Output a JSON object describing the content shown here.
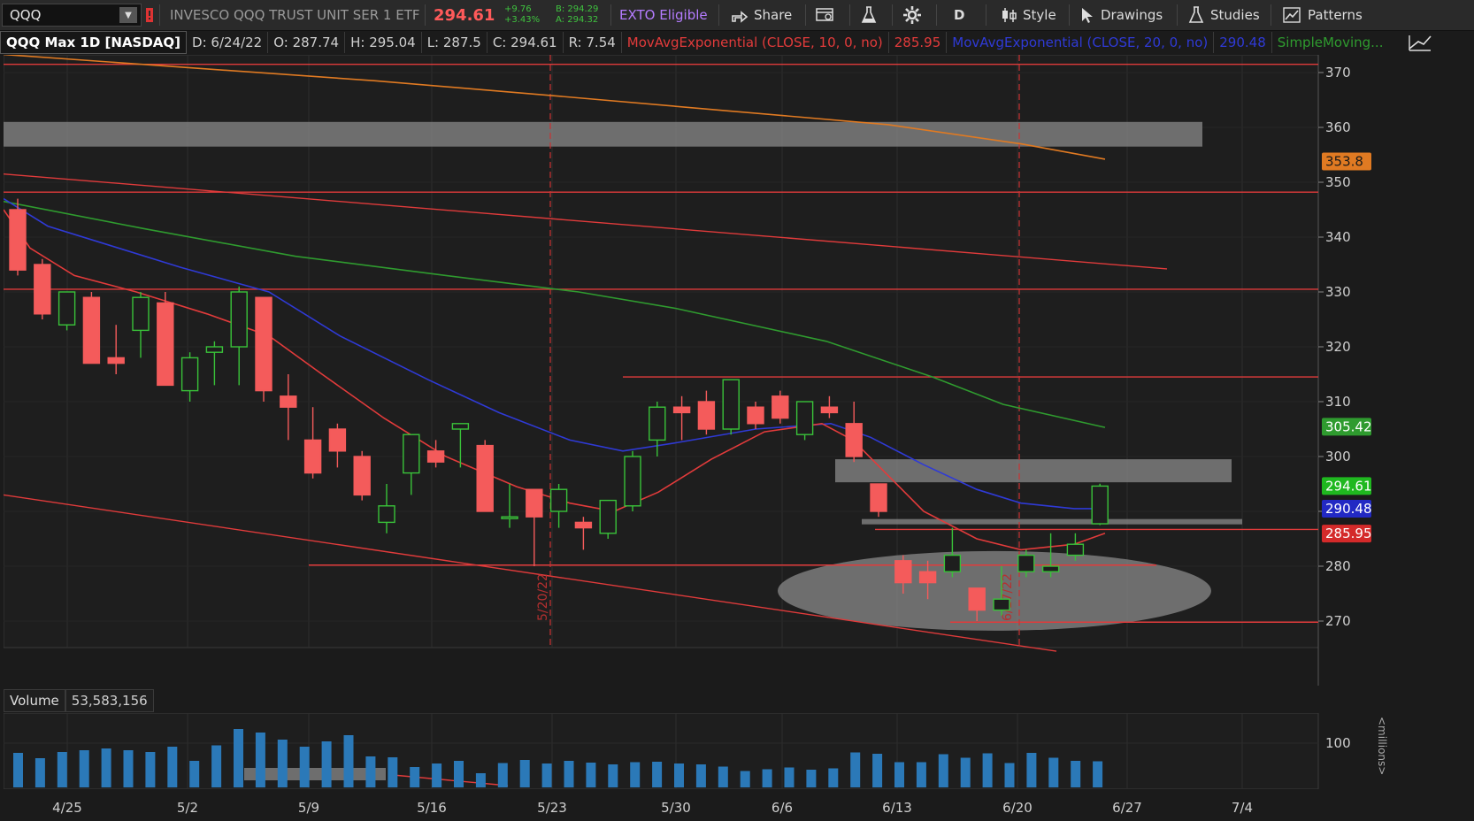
{
  "toolbar": {
    "symbol": "QQQ",
    "description": "INVESCO QQQ TRUST UNIT SER 1 ETF",
    "last_price": "294.61",
    "change_abs": "+9.76",
    "change_pct": "+3.43%",
    "bid": "B: 294.29",
    "ask": "A: 294.32",
    "exto": "EXTO Eligible",
    "share_label": "Share",
    "aggregation": "D",
    "style_label": "Style",
    "drawings_label": "Drawings",
    "studies_label": "Studies",
    "patterns_label": "Patterns"
  },
  "infobar": {
    "title": "QQQ Max 1D [NASDAQ]",
    "date": "D: 6/24/22",
    "open": "O: 287.74",
    "high": "H: 295.04",
    "low": "L: 287.5",
    "close": "C: 294.61",
    "range": "R: 7.54",
    "ema10": "MovAvgExponential (CLOSE, 10, 0, no)",
    "ema10_val": "285.95",
    "ema20": "MovAvgExponential (CLOSE, 20, 0, no)",
    "ema20_val": "290.48",
    "sma": "SimpleMoving..."
  },
  "volume": {
    "label": "Volume",
    "value": "53,583,156",
    "axis_tick": "100",
    "axis_unit": "<millions>"
  },
  "price_badges": {
    "sma200": "353.8",
    "sma50": "305.42",
    "last": "294.61",
    "ema20": "290.48",
    "ema10": "285.95"
  },
  "annotations": {
    "d1": "5/20/22",
    "d2": "6/17/22"
  },
  "colors": {
    "up": "#39c239",
    "down": "#f45b5b",
    "ema10": "#e23b3b",
    "ema20": "#2f3ad6",
    "sma50": "#2f9b2f",
    "sma200": "#e07a22",
    "hline": "#e03b3b",
    "zone": "#7c7c7c"
  },
  "chart_data": {
    "type": "candlestick",
    "y_ticks": [
      270,
      280,
      290,
      300,
      310,
      320,
      330,
      340,
      350,
      360,
      370
    ],
    "x_labels": [
      "4/25",
      "5/2",
      "5/9",
      "5/16",
      "5/23",
      "5/30",
      "6/6",
      "6/13",
      "6/20",
      "6/27",
      "7/4"
    ],
    "candles": [
      {
        "o": 345,
        "h": 347,
        "l": 333,
        "c": 334
      },
      {
        "o": 335,
        "h": 336,
        "l": 325,
        "c": 326
      },
      {
        "o": 324,
        "h": 330,
        "l": 323,
        "c": 330
      },
      {
        "o": 329,
        "h": 330,
        "l": 317,
        "c": 317
      },
      {
        "o": 318,
        "h": 324,
        "l": 315,
        "c": 317
      },
      {
        "o": 323,
        "h": 330,
        "l": 318,
        "c": 329
      },
      {
        "o": 328,
        "h": 330,
        "l": 313,
        "c": 313
      },
      {
        "o": 312,
        "h": 319,
        "l": 310,
        "c": 318
      },
      {
        "o": 319,
        "h": 321,
        "l": 313,
        "c": 320
      },
      {
        "o": 320,
        "h": 331,
        "l": 313,
        "c": 330
      },
      {
        "o": 329,
        "h": 329,
        "l": 310,
        "c": 312
      },
      {
        "o": 311,
        "h": 315,
        "l": 303,
        "c": 309
      },
      {
        "o": 303,
        "h": 309,
        "l": 296,
        "c": 297
      },
      {
        "o": 305,
        "h": 306,
        "l": 298,
        "c": 301
      },
      {
        "o": 300,
        "h": 301,
        "l": 292,
        "c": 293
      },
      {
        "o": 288,
        "h": 295,
        "l": 286,
        "c": 291
      },
      {
        "o": 297,
        "h": 303,
        "l": 293,
        "c": 304
      },
      {
        "o": 301,
        "h": 303,
        "l": 298,
        "c": 299
      },
      {
        "o": 305,
        "h": 306,
        "l": 298,
        "c": 306
      },
      {
        "o": 302,
        "h": 303,
        "l": 290,
        "c": 290
      },
      {
        "o": 289,
        "h": 295,
        "l": 287,
        "c": 289
      },
      {
        "o": 294,
        "h": 294,
        "l": 280,
        "c": 289
      },
      {
        "o": 290,
        "h": 295,
        "l": 287,
        "c": 294
      },
      {
        "o": 288,
        "h": 289,
        "l": 283,
        "c": 287
      },
      {
        "o": 286,
        "h": 292,
        "l": 285,
        "c": 292
      },
      {
        "o": 291,
        "h": 301,
        "l": 290,
        "c": 300
      },
      {
        "o": 303,
        "h": 310,
        "l": 300,
        "c": 309
      },
      {
        "o": 309,
        "h": 311,
        "l": 303,
        "c": 308
      },
      {
        "o": 310,
        "h": 312,
        "l": 304,
        "c": 305
      },
      {
        "o": 305,
        "h": 314,
        "l": 304,
        "c": 314
      },
      {
        "o": 309,
        "h": 310,
        "l": 305,
        "c": 306
      },
      {
        "o": 311,
        "h": 312,
        "l": 306,
        "c": 307
      },
      {
        "o": 304,
        "h": 310,
        "l": 303,
        "c": 310
      },
      {
        "o": 309,
        "h": 311,
        "l": 307,
        "c": 308
      },
      {
        "o": 306,
        "h": 310,
        "l": 299,
        "c": 300
      },
      {
        "o": 295,
        "h": 295,
        "l": 289,
        "c": 290
      },
      {
        "o": 281,
        "h": 282,
        "l": 275,
        "c": 277
      },
      {
        "o": 279,
        "h": 281,
        "l": 274,
        "c": 277
      },
      {
        "o": 279,
        "h": 287,
        "l": 278,
        "c": 282
      },
      {
        "o": 276,
        "h": 276,
        "l": 270,
        "c": 272
      },
      {
        "o": 272,
        "h": 280,
        "l": 271,
        "c": 274
      },
      {
        "o": 279,
        "h": 283,
        "l": 278,
        "c": 282
      },
      {
        "o": 279,
        "h": 286,
        "l": 278,
        "c": 280
      },
      {
        "o": 282,
        "h": 286,
        "l": 281,
        "c": 284
      },
      {
        "o": 287.74,
        "h": 295.04,
        "l": 287.5,
        "c": 294.61
      }
    ],
    "volume_millions": [
      78,
      66,
      80,
      84,
      88,
      84,
      80,
      92,
      60,
      95,
      132,
      124,
      108,
      92,
      104,
      118,
      70,
      68,
      46,
      54,
      60,
      32,
      55,
      62,
      54,
      60,
      56,
      52,
      57,
      58,
      54,
      52,
      47,
      37,
      41,
      45,
      40,
      43,
      79,
      76,
      57,
      57,
      75,
      67,
      77,
      55,
      78,
      67,
      60,
      59
    ]
  }
}
